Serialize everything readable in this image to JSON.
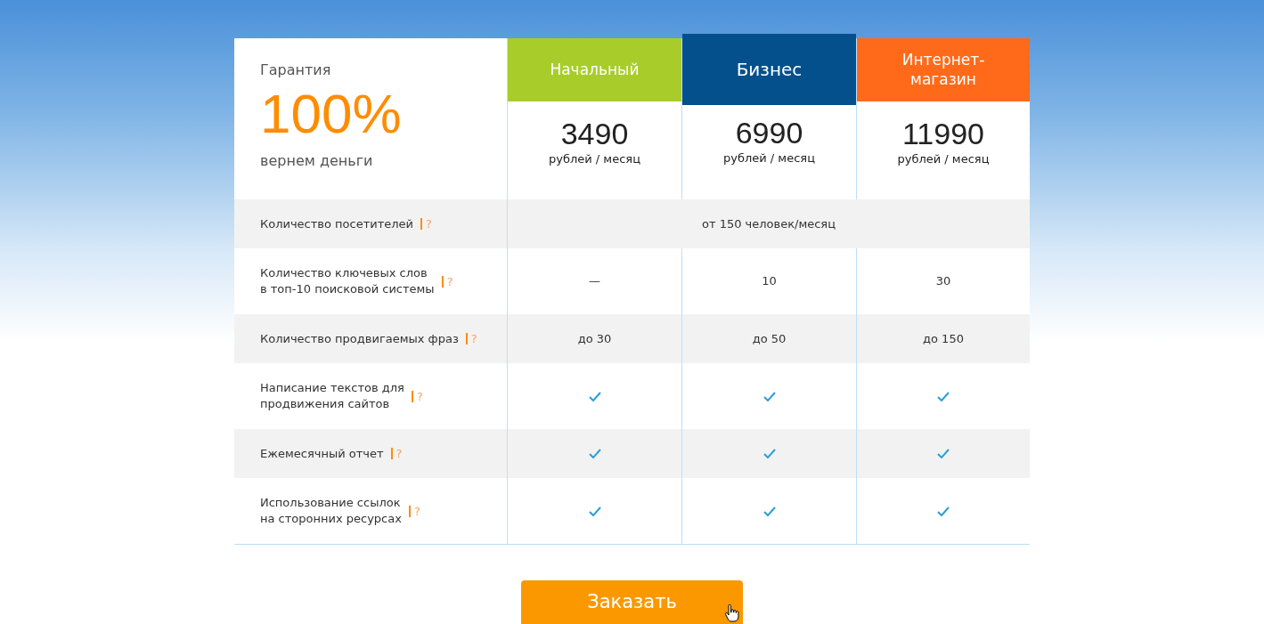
{
  "guarantee": {
    "label": "Гарантия",
    "value": "100%",
    "caption": "вернем деньги"
  },
  "plans": [
    {
      "name": "Начальный",
      "color": "#a8cd2b",
      "selected": false,
      "price": "3490",
      "unit": "рублей / месяц"
    },
    {
      "name": "Бизнес",
      "color": "#03508c",
      "selected": true,
      "price": "6990",
      "unit": "рублей / месяц"
    },
    {
      "name": "Интернет-магазин",
      "color": "#ff6a1a",
      "selected": false,
      "price": "11990",
      "unit": "рублей / месяц"
    }
  ],
  "features": [
    {
      "label": "Количество посетителей",
      "help": "?",
      "kind": "span",
      "value": "от 150 человек/месяц"
    },
    {
      "label": "Количество ключевых слов\nв топ-10 поисковой системы",
      "help": "?",
      "kind": "text",
      "values": [
        "—",
        "10",
        "30"
      ]
    },
    {
      "label": "Количество продвигаемых фраз",
      "help": "?",
      "kind": "text",
      "values": [
        "до 30",
        "до 50",
        "до 150"
      ]
    },
    {
      "label": "Написание текстов для\nпродвижения сайтов",
      "help": "?",
      "kind": "check",
      "checked": [
        true,
        true,
        true
      ]
    },
    {
      "label": "Ежемесячный отчет",
      "help": "?",
      "kind": "check",
      "checked": [
        true,
        true,
        true
      ]
    },
    {
      "label": "Использование ссылок\nна сторонних ресурсах",
      "help": "?",
      "kind": "check",
      "checked": [
        true,
        true,
        true
      ]
    }
  ],
  "order_button": "Заказать"
}
